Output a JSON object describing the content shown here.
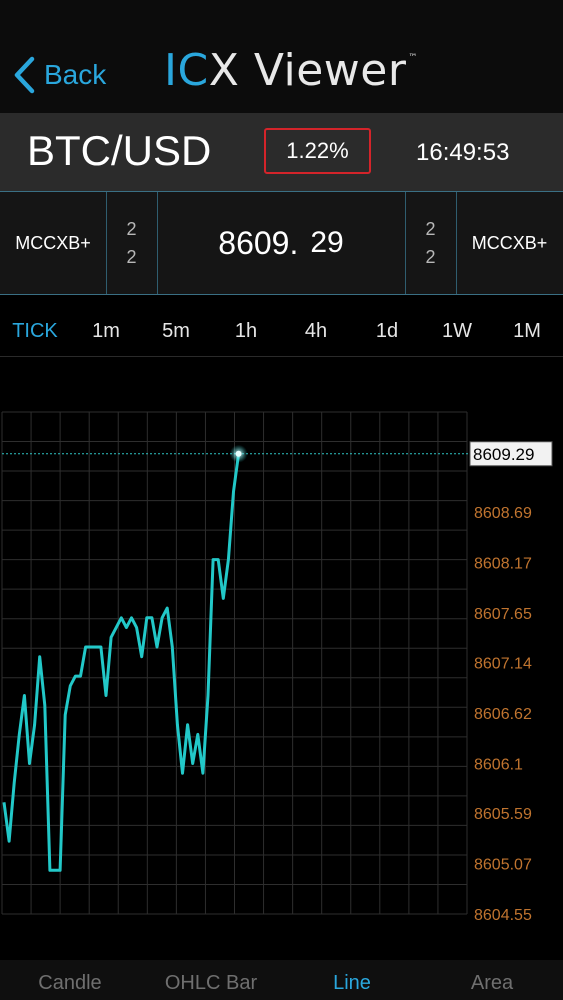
{
  "nav": {
    "back_label": "Back",
    "logo_ic": "IC",
    "logo_rest": "X Viewer",
    "logo_tm": "™"
  },
  "pair": {
    "symbol": "BTC/USD",
    "change_pct": "1.22%",
    "time": "16:49:53"
  },
  "quotes": {
    "bid_source": "MCCXB+",
    "bid_qty_top": "2",
    "bid_qty_bottom": "2",
    "price_int": "8609.",
    "price_dec": "29",
    "ask_qty_top": "2",
    "ask_qty_bottom": "2",
    "ask_source": "MCCXB+"
  },
  "timeframes": {
    "active": "TICK",
    "items": [
      "TICK",
      "1m",
      "5m",
      "1h",
      "4h",
      "1d",
      "1W",
      "1M"
    ]
  },
  "chart_types": {
    "active": "Line",
    "items": [
      "Candle",
      "OHLC Bar",
      "Line",
      "Area"
    ]
  },
  "colors": {
    "accent": "#2aa7dd",
    "line": "#22c8c8",
    "axis_label": "#c0742f",
    "border_red": "#d4242a"
  },
  "chart_data": {
    "type": "line",
    "current_value_label": "8609.29",
    "current_value": 8609.29,
    "y_tick_labels": [
      "8608.69",
      "8608.17",
      "8607.65",
      "8607.14",
      "8606.62",
      "8606.1",
      "8605.59",
      "8605.07",
      "8604.55"
    ],
    "y_ticks": [
      8608.69,
      8608.17,
      8607.65,
      8607.14,
      8606.62,
      8606.1,
      8605.59,
      8605.07,
      8604.55
    ],
    "ylim": [
      8604.55,
      8609.72
    ],
    "grid": true,
    "values": [
      8605.7,
      8605.3,
      8605.9,
      8606.4,
      8606.8,
      8606.1,
      8606.5,
      8607.2,
      8606.7,
      8605.0,
      8605.0,
      8605.0,
      8606.6,
      8606.9,
      8607.0,
      8607.0,
      8607.3,
      8607.3,
      8607.3,
      8607.3,
      8606.8,
      8607.4,
      8607.5,
      8607.6,
      8607.5,
      8607.6,
      8607.5,
      8607.2,
      8607.6,
      8607.6,
      8607.3,
      8607.6,
      8607.7,
      8607.3,
      8606.5,
      8606.0,
      8606.5,
      8606.1,
      8606.4,
      8606.0,
      8606.8,
      8608.2,
      8608.2,
      8607.8,
      8608.2,
      8608.9,
      8609.29
    ]
  }
}
